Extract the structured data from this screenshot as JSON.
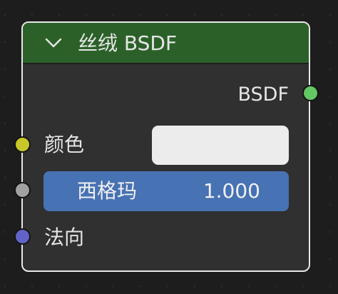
{
  "node": {
    "title": "丝绒 BSDF",
    "output_label": "BSDF",
    "inputs": {
      "color_label": "颜色",
      "color_value": "#ececec",
      "sigma_label": "西格玛",
      "sigma_value": "1.000",
      "normal_label": "法向"
    }
  },
  "colors": {
    "header": "#2b6128",
    "node_body": "#303030",
    "node_border": "#e8e8e8",
    "slider": "#4772b3",
    "socket_bsdf": "#63c763",
    "socket_color": "#c7c729",
    "socket_float": "#a1a1a1",
    "socket_vector": "#6363c7"
  },
  "icons": {
    "collapse": "chevron-down-icon"
  }
}
